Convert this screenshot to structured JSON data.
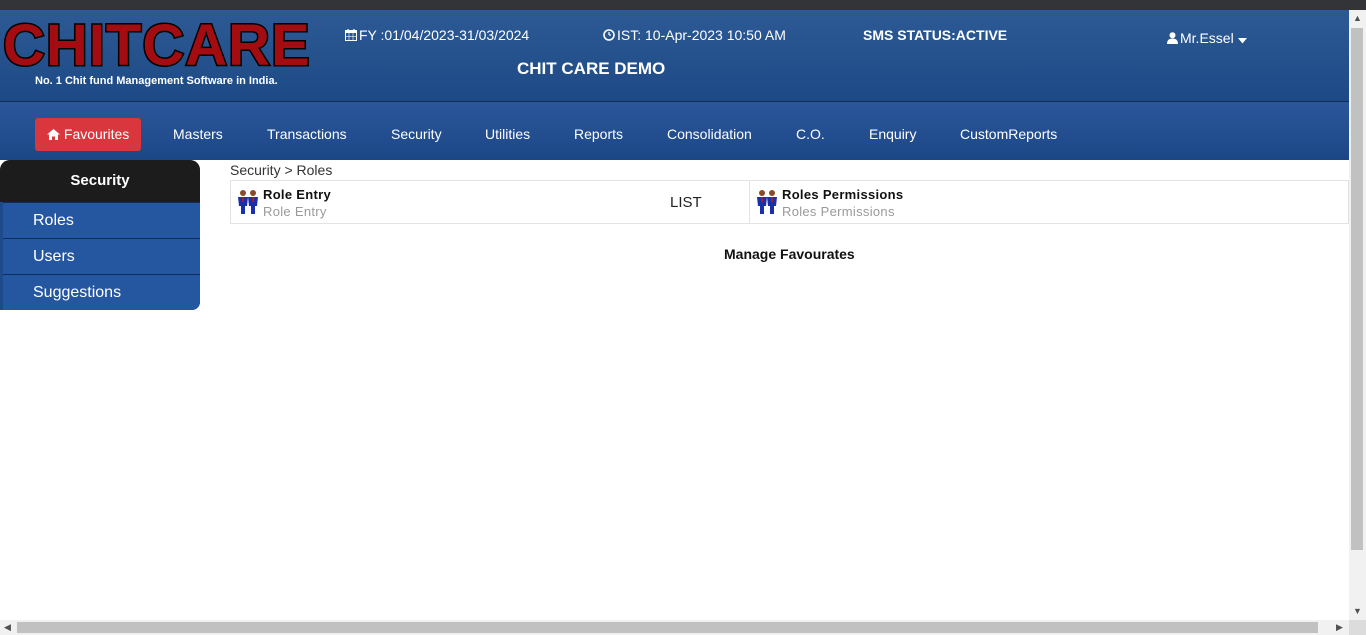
{
  "header": {
    "logo_text": "CHITCARE",
    "tagline": "No. 1 Chit fund Management Software in India.",
    "fy": "FY :01/04/2023-31/03/2024",
    "ist": "IST: 10-Apr-2023 10:50 AM",
    "sms_status": "SMS STATUS:ACTIVE",
    "company": "CHIT CARE DEMO",
    "user": "Mr.Essel"
  },
  "nav": {
    "items": [
      {
        "label": "Favourites",
        "icon": "home-icon",
        "active": true
      },
      {
        "label": "Masters"
      },
      {
        "label": "Transactions"
      },
      {
        "label": "Security"
      },
      {
        "label": "Utilities"
      },
      {
        "label": "Reports"
      },
      {
        "label": "Consolidation"
      },
      {
        "label": "C.O."
      },
      {
        "label": "Enquiry"
      },
      {
        "label": "CustomReports"
      }
    ]
  },
  "sidebar": {
    "title": "Security",
    "items": [
      {
        "label": "Roles"
      },
      {
        "label": "Users"
      },
      {
        "label": "Suggestions"
      }
    ]
  },
  "breadcrumb": "Security > Roles",
  "cards": [
    {
      "title": "Role Entry",
      "subtitle": "Role Entry",
      "action": "LIST",
      "icon": "users-icon"
    },
    {
      "title": "Roles Permissions",
      "subtitle": "Roles Permissions",
      "icon": "users-icon"
    }
  ],
  "manage_favourites": "Manage Favourates",
  "colors": {
    "header_blue": "#2d5a94",
    "nav_active": "#d9363e",
    "logo_red": "#a30d12",
    "sidebar_head": "#1c1c1c"
  }
}
